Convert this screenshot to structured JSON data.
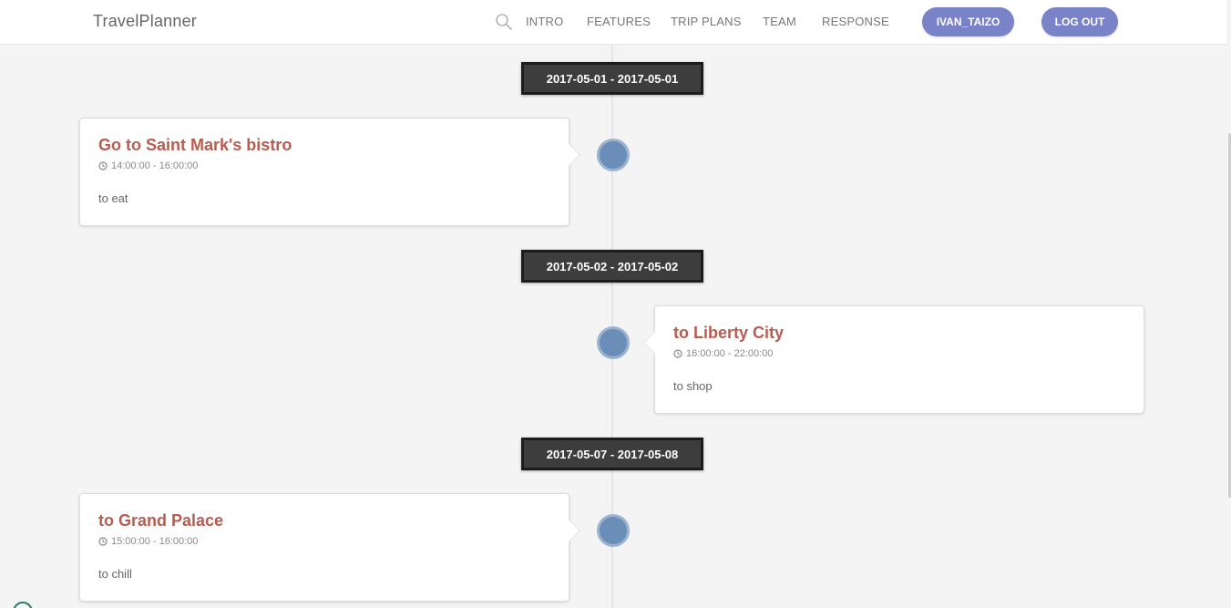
{
  "navbar": {
    "brand": "TravelPlanner",
    "links": [
      "INTRO",
      "FEATURES",
      "TRIP PLANS",
      "TEAM",
      "RESPONSE"
    ],
    "user_button": "IVAN_TAIZO",
    "logout_button": "LOG OUT",
    "search_icon": "search-icon"
  },
  "timeline": {
    "groups": [
      {
        "date_range": "2017-05-01 - 2017-05-01",
        "event": {
          "title": "Go to Saint Mark's bistro",
          "time": "14:00:00 - 16:00:00",
          "description": "to eat",
          "side": "left"
        }
      },
      {
        "date_range": "2017-05-02 - 2017-05-02",
        "event": {
          "title": "to Liberty City",
          "time": "16:00:00 - 22:00:00",
          "description": "to shop",
          "side": "right"
        }
      },
      {
        "date_range": "2017-05-07 - 2017-05-08",
        "event": {
          "title": "to Grand Palace",
          "time": "15:00:00 - 16:00:00",
          "description": "to chill",
          "side": "left"
        }
      }
    ]
  },
  "colors": {
    "accent": "#7a83c8",
    "title": "#b85c4f",
    "dot": "#6a8eb8",
    "date_label": "#3d3d3d"
  }
}
